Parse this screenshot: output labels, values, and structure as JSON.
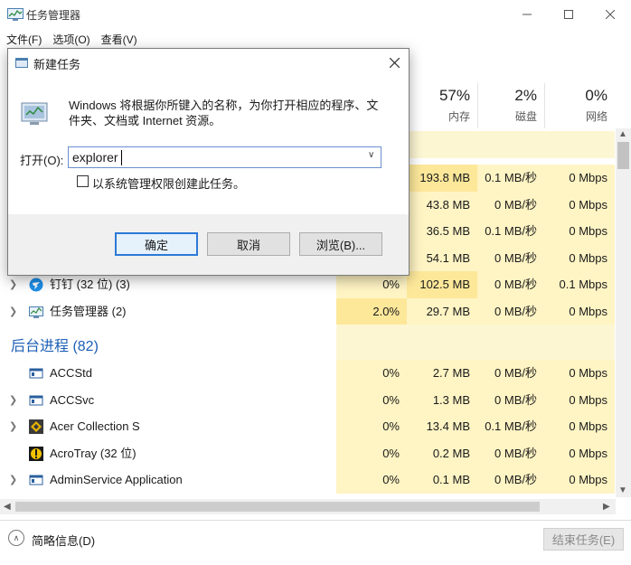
{
  "window": {
    "title": "任务管理器",
    "menu": [
      "文件(F)",
      "选项(O)",
      "查看(V)"
    ]
  },
  "columns": [
    {
      "percent": "",
      "label": ""
    },
    {
      "percent": "57%",
      "label": "内存"
    },
    {
      "percent": "2%",
      "label": "磁盘"
    },
    {
      "percent": "0%",
      "label": "网络"
    }
  ],
  "app_rows_hidden": [
    {
      "cpu": "",
      "mem": "193.8 MB",
      "disk": "0.1 MB/秒",
      "net": "0 Mbps"
    },
    {
      "cpu": "",
      "mem": "43.8 MB",
      "disk": "0 MB/秒",
      "net": "0 Mbps"
    },
    {
      "cpu": "",
      "mem": "36.5 MB",
      "disk": "0.1 MB/秒",
      "net": "0 Mbps"
    },
    {
      "cpu": "",
      "mem": "54.1 MB",
      "disk": "0 MB/秒",
      "net": "0 Mbps"
    }
  ],
  "app_rows": [
    {
      "name": "钉钉 (32 位) (3)",
      "icon": "dingtalk-icon",
      "cpu": "0%",
      "mem": "102.5 MB",
      "disk": "0 MB/秒",
      "net": "0.1 Mbps"
    },
    {
      "name": "任务管理器 (2)",
      "icon": "task-manager-icon",
      "cpu": "2.0%",
      "mem": "29.7 MB",
      "disk": "0 MB/秒",
      "net": "0 Mbps"
    }
  ],
  "background_section": "后台进程 (82)",
  "bg_rows": [
    {
      "name": "ACCStd",
      "icon": "app-window-icon",
      "cpu": "0%",
      "mem": "2.7 MB",
      "disk": "0 MB/秒",
      "net": "0 Mbps"
    },
    {
      "name": "ACCSvc",
      "icon": "app-window-icon",
      "cpu": "0%",
      "mem": "1.3 MB",
      "disk": "0 MB/秒",
      "net": "0 Mbps"
    },
    {
      "name": "Acer Collection S",
      "icon": "acer-collection-icon",
      "cpu": "0%",
      "mem": "13.4 MB",
      "disk": "0.1 MB/秒",
      "net": "0 Mbps"
    },
    {
      "name": "AcroTray (32 位)",
      "icon": "acrotray-icon",
      "cpu": "0%",
      "mem": "0.2 MB",
      "disk": "0 MB/秒",
      "net": "0 Mbps"
    },
    {
      "name": "AdminService Application",
      "icon": "app-window-icon",
      "cpu": "0%",
      "mem": "0.1 MB",
      "disk": "0 MB/秒",
      "net": "0 Mbps"
    }
  ],
  "footer": {
    "fewer_details": "简略信息(D)",
    "end_task": "结束任务(E)"
  },
  "dialog": {
    "title": "新建任务",
    "description": "Windows 将根据你所键入的名称，为你打开相应的程序、文件夹、文档或 Internet 资源。",
    "open_label": "打开(O):",
    "input_value": "explorer",
    "checkbox_label": "以系统管理权限创建此任务。",
    "ok": "确定",
    "cancel": "取消",
    "browse": "浏览(B)..."
  },
  "colors": {
    "highlight_light": "#fff4c4",
    "highlight_strong": "#fde89a",
    "section_blue": "#1c5fb6",
    "accent_border": "#2c7ad6"
  }
}
